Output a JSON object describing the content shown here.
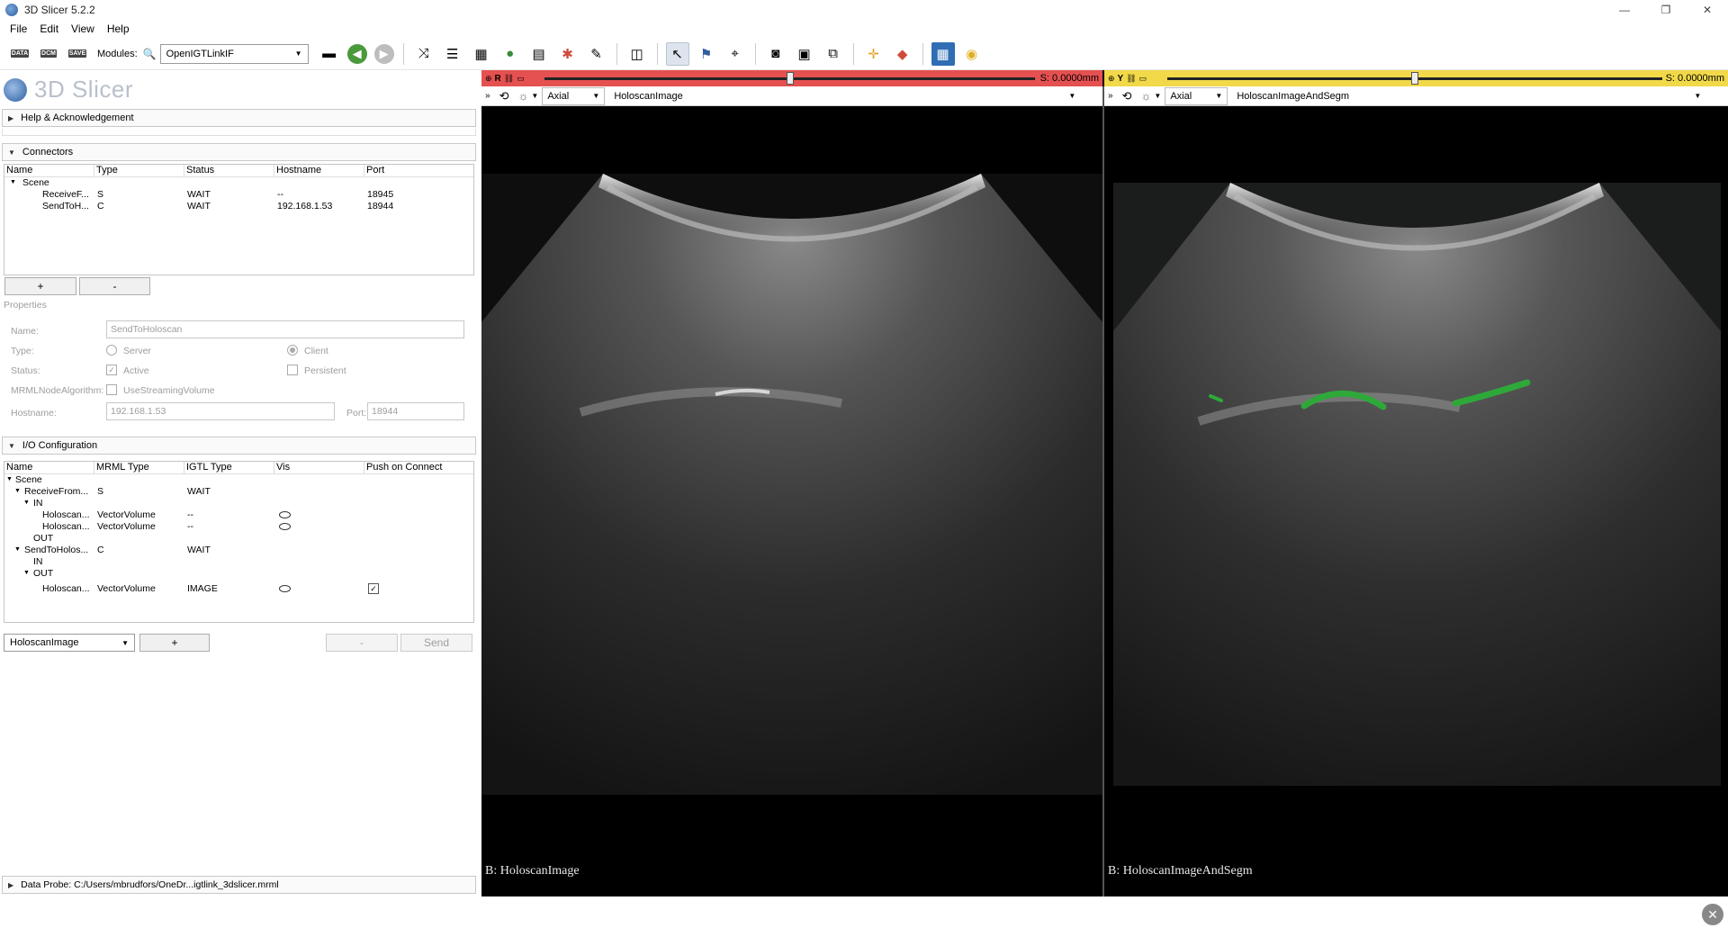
{
  "window": {
    "title": "3D Slicer 5.2.2",
    "minimize": "—",
    "maximize": "❐",
    "close": "✕"
  },
  "menu": [
    "File",
    "Edit",
    "View",
    "Help"
  ],
  "toolbar": {
    "data_label": "DATA",
    "dcm_label": "DCM",
    "save_label": "SAVE",
    "modules_label": "Modules:",
    "module_selected": "OpenIGTLinkIF"
  },
  "logo_text": "3D Slicer",
  "sections": {
    "help": "Help & Acknowledgement",
    "connectors": "Connectors",
    "io": "I/O Configuration",
    "data_probe": "Data Probe: C:/Users/mbrudfors/OneDr...igtlink_3dslicer.mrml"
  },
  "connectors_table": {
    "headers": [
      "Name",
      "Type",
      "Status",
      "Hostname",
      "Port"
    ],
    "scene": "Scene",
    "rows": [
      {
        "name": "ReceiveF...",
        "type": "S",
        "status": "WAIT",
        "hostname": "--",
        "port": "18945"
      },
      {
        "name": "SendToH...",
        "type": "C",
        "status": "WAIT",
        "hostname": "192.168.1.53",
        "port": "18944"
      }
    ],
    "add": "+",
    "remove": "-"
  },
  "properties": {
    "title": "Properties",
    "name_label": "Name:",
    "name_value": "SendToHoloscan",
    "type_label": "Type:",
    "server": "Server",
    "client": "Client",
    "status_label": "Status:",
    "active": "Active",
    "persistent": "Persistent",
    "mrml_label": "MRMLNodeAlgorithm:",
    "streaming": "UseStreamingVolume",
    "hostname_label": "Hostname:",
    "hostname_value": "192.168.1.53",
    "port_label": "Port:",
    "port_value": "18944"
  },
  "io_table": {
    "headers": [
      "Name",
      "MRML Type",
      "IGTL Type",
      "Vis",
      "Push on Connect"
    ],
    "scene": "Scene",
    "receive": {
      "name": "ReceiveFrom...",
      "type": "S",
      "status": "WAIT"
    },
    "in": "IN",
    "out": "OUT",
    "in_rows": [
      {
        "name": "Holoscan...",
        "mrml": "VectorVolume",
        "igtl": "--"
      },
      {
        "name": "Holoscan...",
        "mrml": "VectorVolume",
        "igtl": "--"
      }
    ],
    "send": {
      "name": "SendToHolos...",
      "type": "C",
      "status": "WAIT"
    },
    "out_rows": [
      {
        "name": "Holoscan...",
        "mrml": "VectorVolume",
        "igtl": "IMAGE",
        "push": "✓"
      }
    ]
  },
  "io_bottom": {
    "combo": "HoloscanImage",
    "add": "+",
    "remove": "-",
    "send": "Send"
  },
  "viewers": {
    "red": {
      "letter": "R",
      "offset": "S: 0.0000mm",
      "orientation": "Axial",
      "volume": "HoloscanImage",
      "label": "B: HoloscanImage",
      "slider_fraction": 0.5
    },
    "yellow": {
      "letter": "Y",
      "offset": "S: 0.0000mm",
      "orientation": "Axial",
      "volume": "HoloscanImageAndSegm",
      "label": "B: HoloscanImageAndSegm",
      "slider_fraction": 0.5
    }
  },
  "colors": {
    "red_bar": "#e55050",
    "yellow_bar": "#f1d949",
    "segmentation": "#2fa83a"
  }
}
